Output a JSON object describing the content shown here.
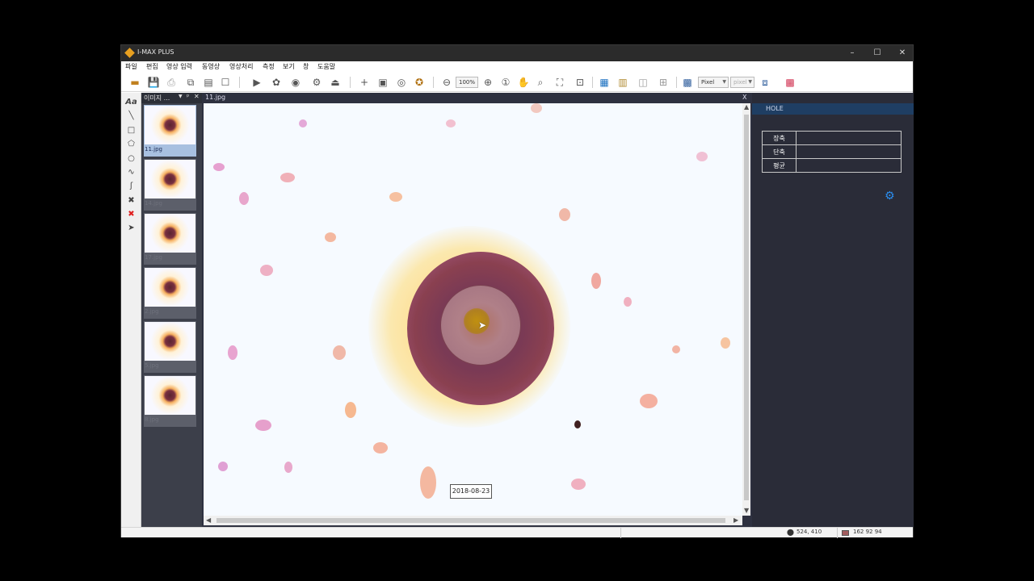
{
  "window": {
    "title": "I-MAX PLUS",
    "minimize": "–",
    "maximize": "☐",
    "close": "✕"
  },
  "menu": [
    "파일",
    "편집",
    "영상 입력",
    "동영상",
    "영상처리",
    "측정",
    "보기",
    "창",
    "도움말"
  ],
  "toolbar": {
    "zoom_value": "100%",
    "unit_select": "Pixel",
    "unit_select2": "pixel"
  },
  "thumbnail_panel": {
    "title": "이미지 ...",
    "pin": "ᵖ",
    "close": "✕",
    "items": [
      {
        "name": "11.jpg"
      },
      {
        "name": "14.jpg"
      },
      {
        "name": "17.jpg"
      },
      {
        "name": "2.jpg"
      },
      {
        "name": "5.jpg"
      },
      {
        "name": "8.jpg"
      }
    ]
  },
  "viewer": {
    "tab_title": "11.jpg",
    "close": "X",
    "date_label": "2018-08-23"
  },
  "right_panel": {
    "header": "HOLE",
    "rows": [
      {
        "label": "장축",
        "value": ""
      },
      {
        "label": "단축",
        "value": ""
      },
      {
        "label": "평균",
        "value": ""
      }
    ]
  },
  "status": {
    "coords": "524, 410",
    "rgb": "162 92 94",
    "swatch_color": "#a25c5e"
  },
  "colors": {
    "title_bar": "#2b2b2b",
    "panel_bg": "#2a2c38",
    "header_blue": "#1f3e63",
    "accent": "#2a8ef0"
  }
}
